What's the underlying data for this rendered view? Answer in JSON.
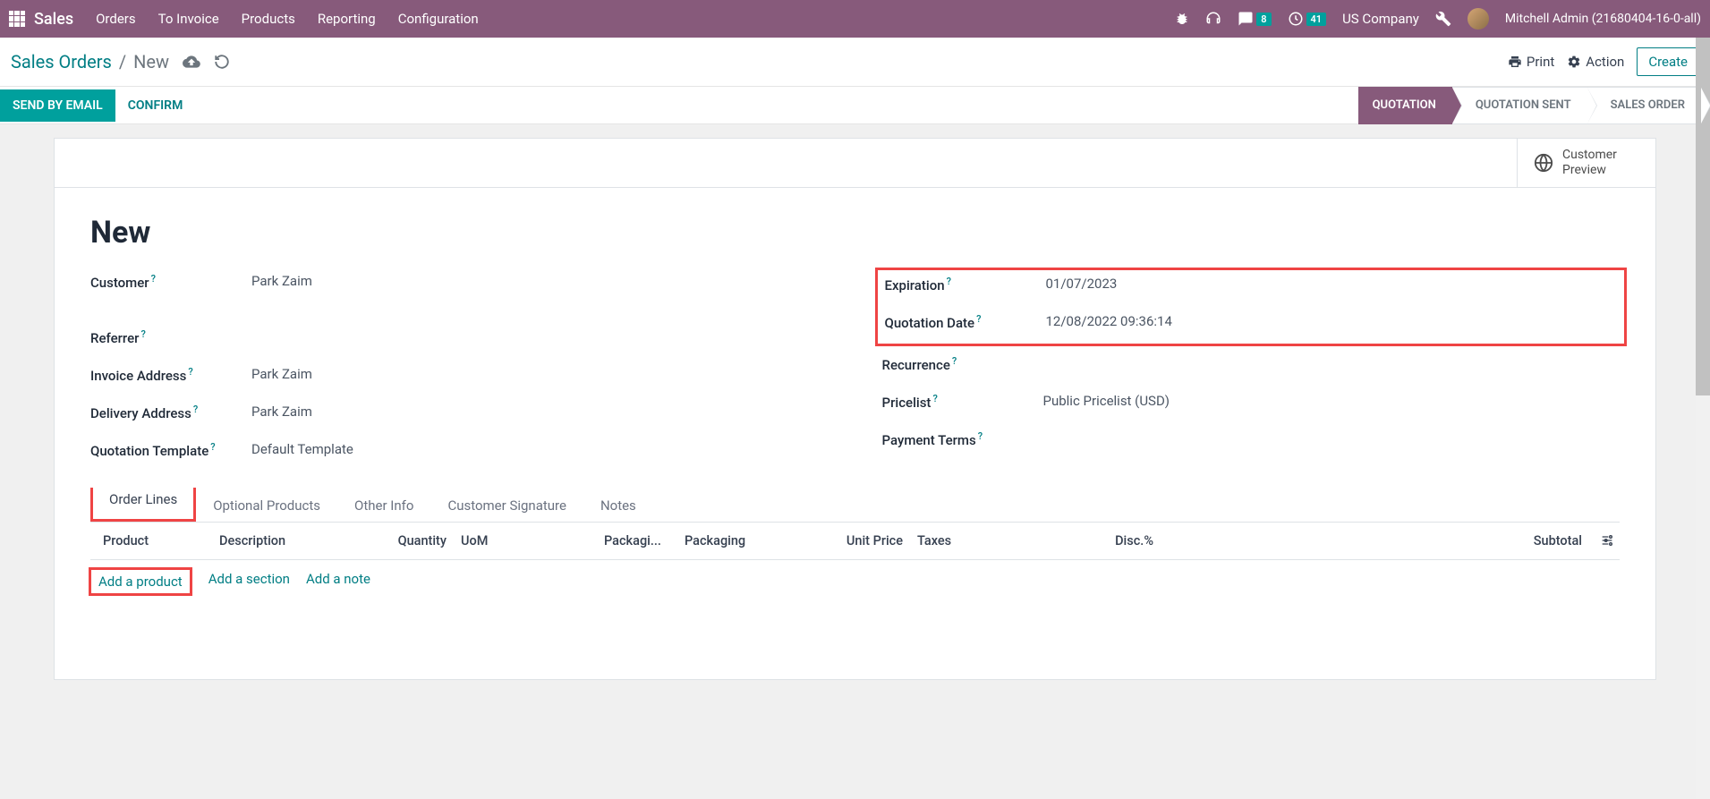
{
  "topbar": {
    "brand": "Sales",
    "menu": [
      "Orders",
      "To Invoice",
      "Products",
      "Reporting",
      "Configuration"
    ],
    "messages_badge": "8",
    "activities_badge": "41",
    "company": "US Company",
    "user": "Mitchell Admin (21680404-16-0-all)"
  },
  "breadcrumb": {
    "root": "Sales Orders",
    "current": "New",
    "print_label": "Print",
    "action_label": "Action",
    "create_label": "Create"
  },
  "statusbar": {
    "send_email": "SEND BY EMAIL",
    "confirm": "CONFIRM",
    "steps": [
      "QUOTATION",
      "QUOTATION SENT",
      "SALES ORDER"
    ]
  },
  "sheet": {
    "customer_preview": "Customer Preview",
    "title": "New",
    "left_fields": [
      {
        "label": "Customer",
        "value": "Park Zaim"
      },
      {
        "label": "Referrer",
        "value": ""
      },
      {
        "label": "Invoice Address",
        "value": "Park Zaim"
      },
      {
        "label": "Delivery Address",
        "value": "Park Zaim"
      },
      {
        "label": "Quotation Template",
        "value": "Default Template"
      }
    ],
    "right_fields_hl": [
      {
        "label": "Expiration",
        "value": "01/07/2023"
      },
      {
        "label": "Quotation Date",
        "value": "12/08/2022 09:36:14"
      }
    ],
    "right_fields": [
      {
        "label": "Recurrence",
        "value": ""
      },
      {
        "label": "Pricelist",
        "value": "Public Pricelist (USD)"
      },
      {
        "label": "Payment Terms",
        "value": ""
      }
    ],
    "tabs": [
      "Order Lines",
      "Optional Products",
      "Other Info",
      "Customer Signature",
      "Notes"
    ],
    "columns": [
      "Product",
      "Description",
      "Quantity",
      "UoM",
      "Packagi...",
      "Packaging",
      "Unit Price",
      "Taxes",
      "Disc.%",
      "Subtotal"
    ],
    "add_product": "Add a product",
    "add_section": "Add a section",
    "add_note": "Add a note"
  }
}
